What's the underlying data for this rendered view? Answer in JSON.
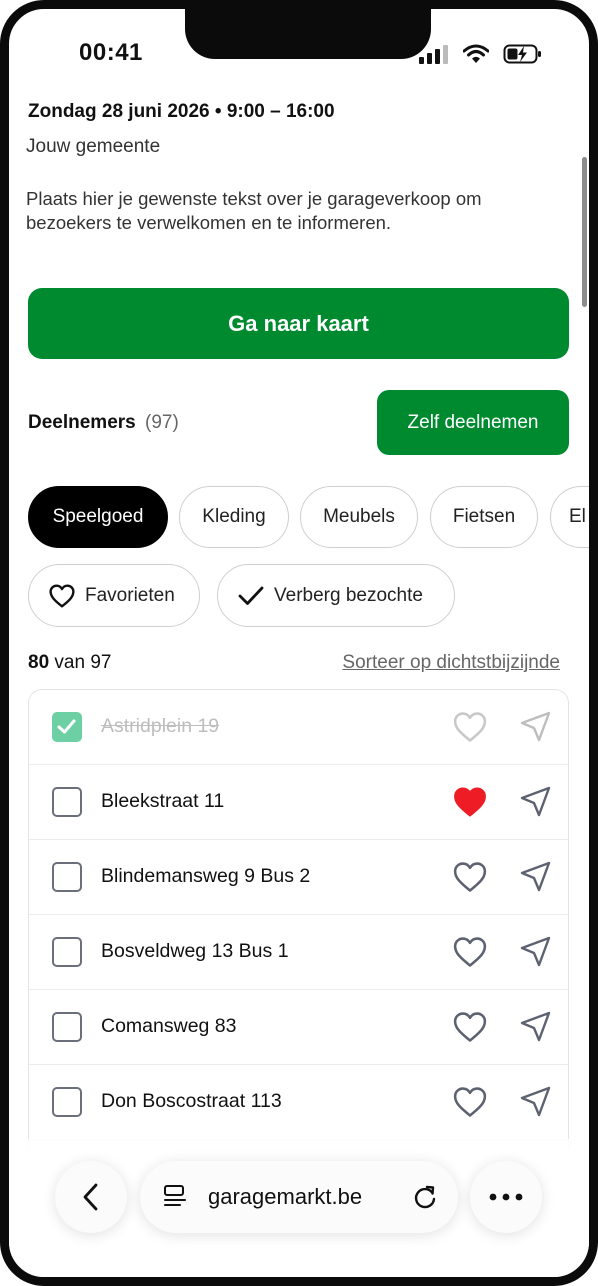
{
  "status_bar": {
    "time": "00:41"
  },
  "event": {
    "date_line": "Zondag 28 juni 2026 • 9:00 – 16:00",
    "municipality": "Jouw gemeente",
    "intro": "Plaats hier je gewenste tekst over je garageverkoop om bezoekers te verwelkomen en te informeren."
  },
  "map_button": {
    "label": "Ga naar kaart"
  },
  "participants": {
    "label": "Deelnemers",
    "count": "(97)",
    "join_label": "Zelf deelnemen"
  },
  "categories": [
    "Speelgoed",
    "Kleding",
    "Meubels",
    "Fietsen",
    "El"
  ],
  "active_category": "Speelgoed",
  "filters": {
    "favorites": "Favorieten",
    "hide_visited": "Verberg bezochte"
  },
  "results": {
    "shown": "80",
    "of_text": "van 97",
    "sort_label": "Sorteer op dichtstbijzijnde"
  },
  "addresses": [
    {
      "label": "Astridplein 19",
      "visited": true,
      "favorite": false
    },
    {
      "label": "Bleekstraat 11",
      "visited": false,
      "favorite": true
    },
    {
      "label": "Blindemansweg 9 Bus 2",
      "visited": false,
      "favorite": false
    },
    {
      "label": "Bosveldweg 13 Bus 1",
      "visited": false,
      "favorite": false
    },
    {
      "label": "Comansweg 83",
      "visited": false,
      "favorite": false
    },
    {
      "label": "Don Boscostraat 113",
      "visited": false,
      "favorite": false
    }
  ],
  "browser": {
    "url": "garagemarkt.be"
  },
  "colors": {
    "primary_green": "#008a30",
    "favorite_red": "#ee1c25",
    "checked_green": "#6dd0a5"
  }
}
